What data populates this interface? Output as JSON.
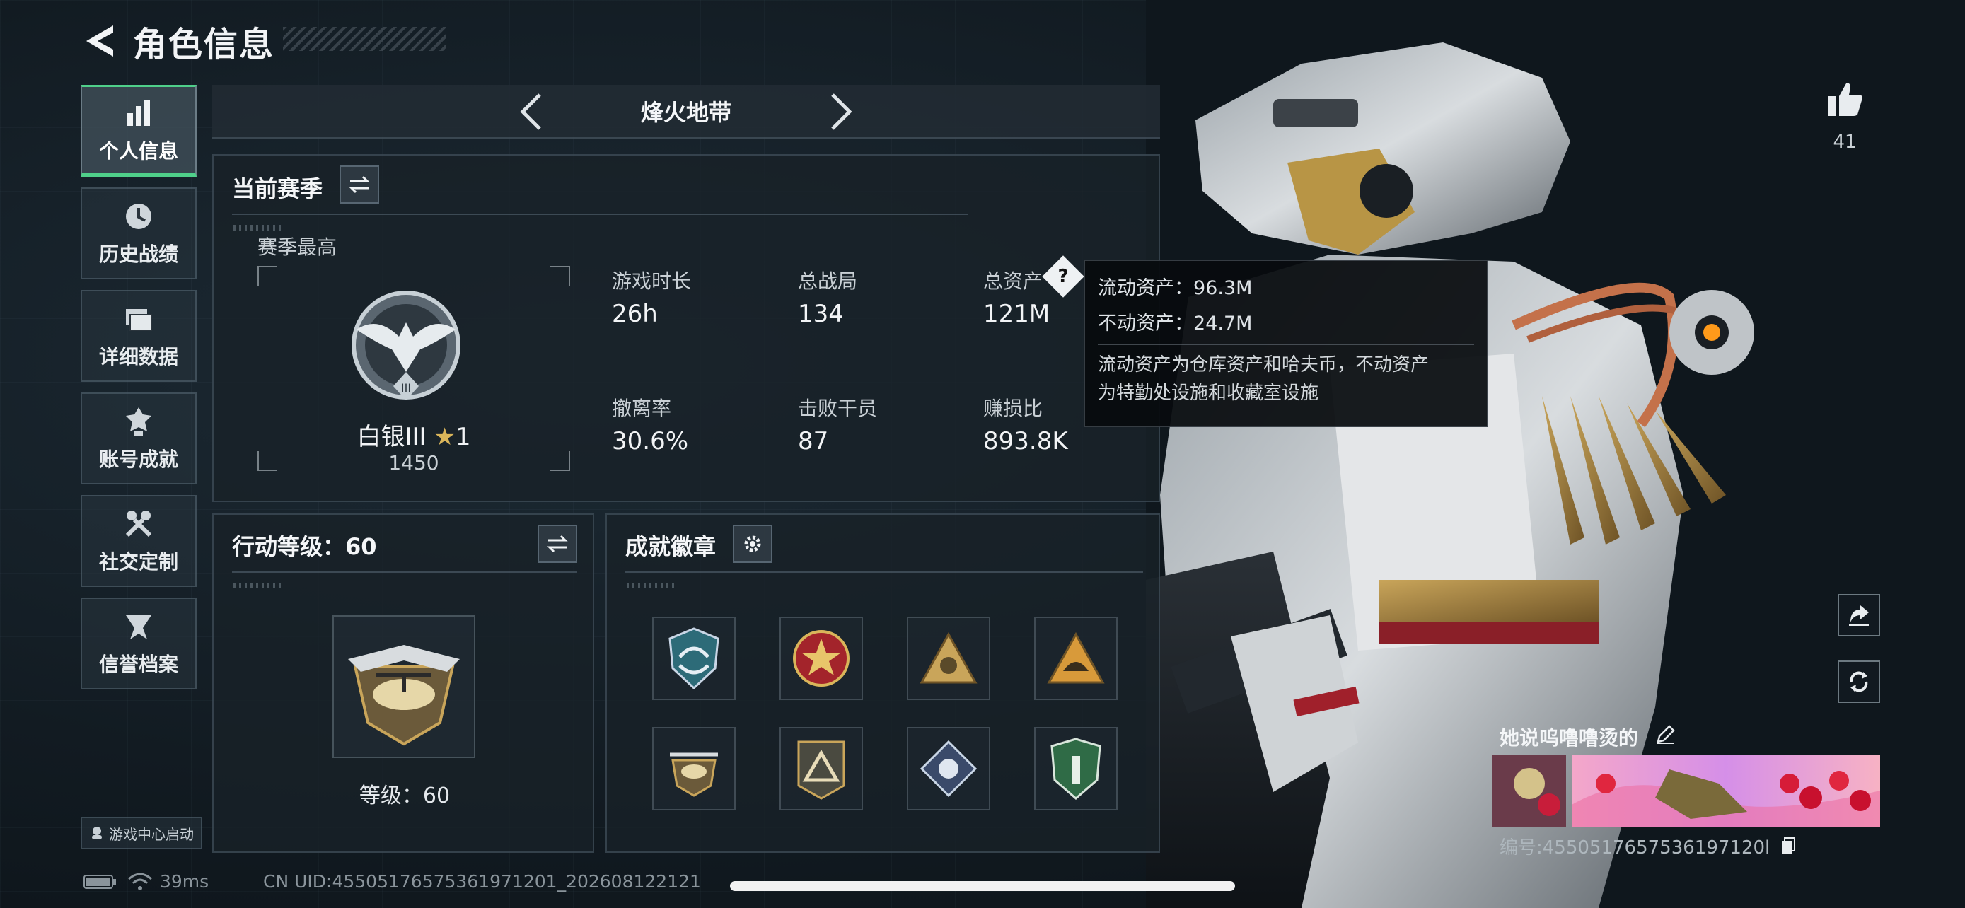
{
  "header": {
    "title": "角色信息"
  },
  "sidebar": {
    "items": [
      {
        "label": "个人信息",
        "active": true,
        "icon": "bar-chart-icon"
      },
      {
        "label": "历史战绩",
        "active": false,
        "icon": "history-icon"
      },
      {
        "label": "详细数据",
        "active": false,
        "icon": "folder-icon"
      },
      {
        "label": "账号成就",
        "active": false,
        "icon": "achievement-icon"
      },
      {
        "label": "社交定制",
        "active": false,
        "icon": "tools-icon"
      },
      {
        "label": "信誉档案",
        "active": false,
        "icon": "credit-icon"
      }
    ],
    "launch_label": "游戏中心启动"
  },
  "mode": {
    "title": "烽火地带"
  },
  "season": {
    "title": "当前赛季",
    "best_label": "赛季最高",
    "rank_name": "白银III",
    "rank_stars": "1",
    "rank_score": "1450",
    "stats": [
      {
        "label": "游戏时长",
        "value": "26h"
      },
      {
        "label": "总战局",
        "value": "134"
      },
      {
        "label": "总资产",
        "value": "121M"
      },
      {
        "label": "撤离率",
        "value": "30.6%"
      },
      {
        "label": "击败干员",
        "value": "87"
      },
      {
        "label": "赚损比",
        "value": "893.8K"
      }
    ]
  },
  "tooltip": {
    "liquid": "流动资产：96.3M",
    "fixed": "不动资产：24.7M",
    "desc_line1": "流动资产为仓库资产和哈夫币，不动资产",
    "desc_line2": "为特勤处设施和收藏室设施"
  },
  "action_level": {
    "title": "行动等级：60",
    "level_text": "等级：60"
  },
  "achievements": {
    "title": "成就徽章",
    "badges": [
      "shield-arrows-badge",
      "red-star-medal",
      "triangle-emblem-badge",
      "helmet-triangle-badge",
      "helicopter-badge",
      "triangle-plate-badge",
      "diamond-flower-badge",
      "green-shield-badge"
    ]
  },
  "profile": {
    "likes": "41",
    "player_name": "她说呜噜噜烫的",
    "player_id": "编号:4550517657536197120l"
  },
  "status_bar": {
    "ping": "39ms",
    "uid": "CN UID:455051765753619712​01_202608122121"
  },
  "colors": {
    "accent": "#4fd08a",
    "tooltip_bg": "#080b0e",
    "panel_bg": "#182128"
  }
}
